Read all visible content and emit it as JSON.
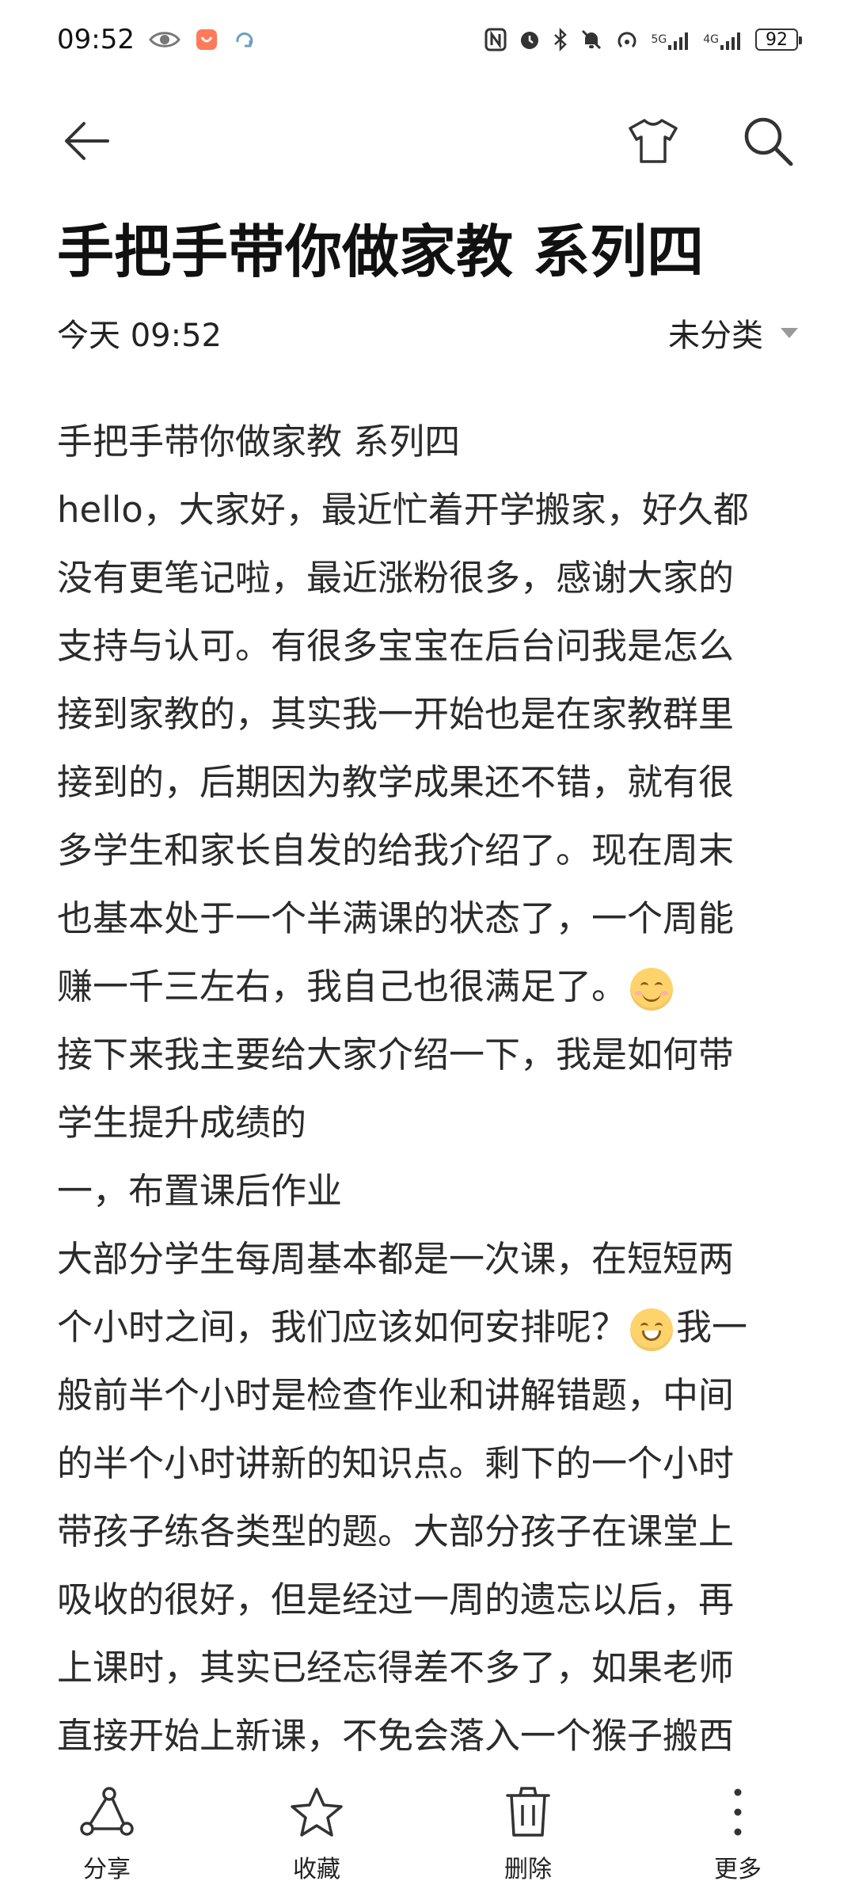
{
  "status": {
    "time": "09:52",
    "network1": "5G",
    "network2": "4G",
    "battery": "92"
  },
  "note": {
    "title": "手把手带你做家教 系列四",
    "date": "今天 09:52",
    "category": "未分类",
    "lines": [
      "手把手带你做家教 系列四",
      "hello，大家好，最近忙着开学搬家，好久都",
      "没有更笔记啦，最近涨粉很多，感谢大家的",
      "支持与认可。有很多宝宝在后台问我是怎么",
      "接到家教的，其实我一开始也是在家教群里",
      "接到的，后期因为教学成果还不错，就有很",
      "多学生和家长自发的给我介绍了。现在周末",
      "也基本处于一个半满课的状态了，一个周能",
      "赚一千三左右，我自己也很满足了。",
      "接下来我主要给大家介绍一下，我是如何带",
      "学生提升成绩的",
      "一，布置课后作业",
      "大部分学生每周基本都是一次课，在短短两",
      "个小时之间，我们应该如何安排呢？",
      "我一",
      "般前半个小时是检查作业和讲解错题，中间",
      "的半个小时讲新的知识点。剩下的一个小时",
      "带孩子练各类型的题。大部分孩子在课堂上",
      "吸收的很好，但是经过一周的遗忘以后，再",
      "上课时，其实已经忘得差不多了，如果老师",
      "直接开始上新课，不免会落入一个猴子搬西"
    ]
  },
  "bottom_bar": {
    "share": "分享",
    "favorite": "收藏",
    "delete": "删除",
    "more": "更多"
  }
}
